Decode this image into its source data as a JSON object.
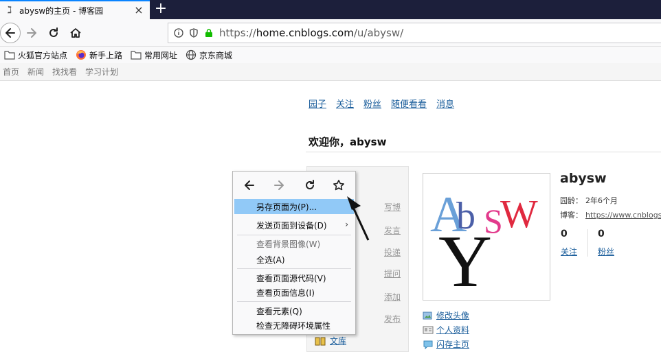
{
  "browser": {
    "tab_title": "abysw的主页 - 博客园",
    "url_prefix": "https://",
    "url_domain": "home.cnblogs.com",
    "url_path": "/u/abysw/",
    "bookmarks": [
      "火狐官方站点",
      "新手上路",
      "常用网址",
      "京东商城"
    ]
  },
  "site_nav": [
    "首页",
    "新闻",
    "找找看",
    "学习计划"
  ],
  "top_links": [
    "园子",
    "关注",
    "粉丝",
    "随便看看",
    "消息"
  ],
  "welcome": "欢迎你，abysw",
  "left_panel": {
    "items": [
      "写博",
      "发言",
      "投递",
      "提问",
      "添加",
      "发布"
    ],
    "wenku": "文库"
  },
  "profile": {
    "username": "abysw",
    "age_label": "园龄：",
    "age_value": "2年6个月",
    "blog_label": "博客：",
    "blog_url": "https://www.cnblogs",
    "follow_count": "0",
    "follow_label": "关注",
    "fans_count": "0",
    "fans_label": "粉丝",
    "links": [
      "修改头像",
      "个人资料",
      "闪存主页"
    ]
  },
  "context_menu": {
    "items": [
      {
        "label": "另存页面为(P)...",
        "state": "highlighted"
      },
      {
        "label": "发送页面到设备(D)",
        "state": "submenu"
      },
      {
        "label": "查看背景图像(W)",
        "state": "disabled"
      },
      {
        "label": "全选(A)",
        "state": "normal"
      },
      {
        "label": "查看页面源代码(V)",
        "state": "normal"
      },
      {
        "label": "查看页面信息(I)",
        "state": "normal"
      },
      {
        "label": "查看元素(Q)",
        "state": "normal"
      },
      {
        "label": "检查无障碍环境属性",
        "state": "normal"
      }
    ]
  },
  "colors": {
    "tabbar_bg": "#1c1f3b",
    "link_blue": "#1a5d9b",
    "menu_highlight": "#91c9f7",
    "lock_green": "#12bc00"
  }
}
